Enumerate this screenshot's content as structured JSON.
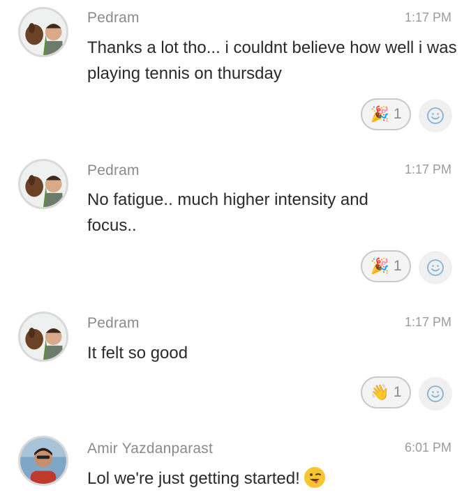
{
  "messages": [
    {
      "sender": "Pedram",
      "time": "1:17 PM",
      "text": "Thanks a lot tho... i couldnt believe how well i was playing tennis on thursday",
      "reaction": {
        "emoji": "🎉",
        "icon": "party-popper-icon",
        "count": "1"
      }
    },
    {
      "sender": "Pedram",
      "time": "1:17 PM",
      "text": "No fatigue.. much higher intensity and focus..",
      "reaction": {
        "emoji": "🎉",
        "icon": "party-popper-icon",
        "count": "1"
      }
    },
    {
      "sender": "Pedram",
      "time": "1:17 PM",
      "text": "It felt so good",
      "reaction": {
        "emoji": "👋",
        "icon": "waving-hand-icon",
        "count": "1"
      }
    },
    {
      "sender": "Amir Yazdanparast",
      "time": "6:01 PM",
      "text": "Lol we're just getting started!",
      "inline_emoji": "winking-tongue-face-icon"
    }
  ],
  "colors": {
    "sender": "#8a8a8a",
    "timestamp": "#9b9b9b",
    "text": "#2a2a2a",
    "reaction_border": "#c9c9c9",
    "add_reaction_icon": "#7fb3d9"
  }
}
